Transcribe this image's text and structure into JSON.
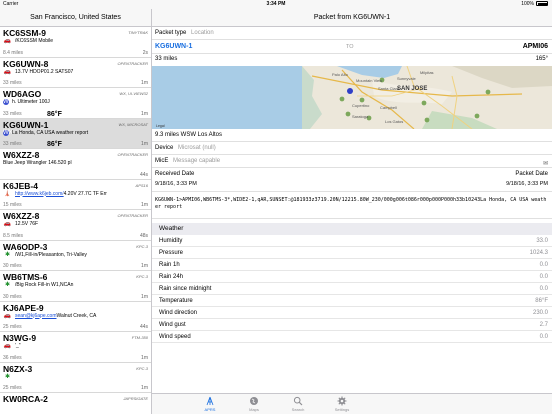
{
  "status_bar": {
    "carrier": "Carrier",
    "time": "3:34 PM",
    "battery": "100%"
  },
  "left": {
    "title": "San Francisco, United States",
    "stations": [
      {
        "callsign": "KC6SSM-9",
        "source": "TINYTRAK",
        "symbol": "🚗",
        "sym_class": "sym-car",
        "comment": "/KC6SSM Mobile",
        "distance": "8.4 miles",
        "age": "2s",
        "temp": "",
        "link": false
      },
      {
        "callsign": "KG6UWN-8",
        "source": "OPENTRACKER",
        "symbol": "🚗",
        "sym_class": "sym-car",
        "comment": "13.7V HDOP01.2 SATS07",
        "distance": "33 miles",
        "age": "1m",
        "temp": "",
        "link": false
      },
      {
        "callsign": "WD6AGO",
        "source": "WX, UI-VIEW32",
        "symbol": "WX",
        "sym_class": "sym-blue",
        "comment": "h. Ultimeter 100J",
        "distance": "33 miles",
        "age": "1m",
        "temp": "86°F",
        "link": false
      },
      {
        "callsign": "KG6UWN-1",
        "source": "WX, MICROSAT",
        "symbol": "WX",
        "sym_class": "sym-blue",
        "comment": "La Honda, CA USA  weather report",
        "distance": "33 miles",
        "age": "1m",
        "temp": "86°F",
        "link": false,
        "selected": true
      },
      {
        "callsign": "W6XZZ-8",
        "source": "OPENTRACKER",
        "symbol": "",
        "sym_class": "",
        "comment": "Blue Jeep Wrangler 146.520 pl",
        "distance": "",
        "age": "44s",
        "temp": "",
        "link": false
      },
      {
        "callsign": "K6JEB-4",
        "source": "APS16",
        "symbol": "🗼",
        "sym_class": "sym-gray",
        "comment": "http://www.k6jeb.com/",
        "comment2": " 4.20V  27.7C TF Err",
        "distance": "15 miles",
        "age": "1m",
        "temp": "",
        "link": true
      },
      {
        "callsign": "W6XZZ-8",
        "source": "OPENTRACKER",
        "symbol": "🚗",
        "sym_class": "sym-car",
        "comment": "12.5V  76F",
        "distance": "8.5 miles",
        "age": "48s",
        "temp": "",
        "link": false
      },
      {
        "callsign": "WA6ODP-3",
        "source": "KPC-3",
        "symbol": "✱",
        "sym_class": "sym-green",
        "comment": "/W1,Fill-in/Pleasanton, Tri-Valley",
        "distance": "30 miles",
        "age": "1m",
        "temp": "",
        "link": false
      },
      {
        "callsign": "WB6TMS-6",
        "source": "KPC-3",
        "symbol": "✱",
        "sym_class": "sym-green",
        "comment": "/Big Rock Fill-in W1,NCAn",
        "distance": "30 miles",
        "age": "1m",
        "temp": "",
        "link": false
      },
      {
        "callsign": "KJ6APE-9",
        "source": "",
        "symbol": "🚗",
        "sym_class": "sym-car",
        "comment": "sean@kj6ape.com",
        "comment2": " Walnut Creek, CA",
        "distance": "25 miles",
        "age": "44s",
        "temp": "",
        "link": true
      },
      {
        "callsign": "N3WG-9",
        "source": "FTM-350",
        "symbol": "🚗",
        "sym_class": "sym-car",
        "comment": "'_\"",
        "distance": "36 miles",
        "age": "1m",
        "temp": "",
        "link": false
      },
      {
        "callsign": "N6ZX-3",
        "source": "KPC-3",
        "symbol": "✱",
        "sym_class": "sym-green",
        "comment": "",
        "distance": "25 miles",
        "age": "1m",
        "temp": "",
        "link": false
      },
      {
        "callsign": "KW0RCA-2",
        "source": "JAPRSIGATE",
        "symbol": "",
        "sym_class": "",
        "comment": "",
        "distance": "",
        "age": "",
        "temp": "",
        "link": false
      }
    ]
  },
  "right": {
    "title": "Packet from KG6UWN-1",
    "packet_type_label": "Packet type",
    "packet_type_value": "Location",
    "from": "KG6UWN-1",
    "to_label": "TO",
    "to": "APMI06",
    "distance": "33 miles",
    "bearing": "165°",
    "map_legal": "Legal",
    "map_places": [
      "Sunnyvale",
      "Milpitas",
      "Santa Clara",
      "SAN JOSE",
      "Cupertino",
      "Saratoga",
      "Los Gatos",
      "Campbell",
      "Mountain View",
      "Palo Alto"
    ],
    "map_caption": "9.3 miles WSW Los Altos",
    "device_label": "Device",
    "device_value": "Microsat (null)",
    "mice_label": "MicE",
    "mice_value": "Message capable",
    "received_label": "Received Date",
    "received_value": "9/18/16, 3:33 PM",
    "packet_date_label": "Packet Date",
    "packet_date_value": "9/18/16, 3:33 PM",
    "raw_packet": "KG6UWN-1>APMI06,WB6TMS-3*,WIDE2-1,qAR,SUNSET:@181933z3719.20N/12215.80W_230/000g006t086r000p000P000h33b10243La Honda, CA USA  weather report",
    "weather_header": "Weather",
    "weather": [
      {
        "label": "Humidity",
        "value": "33.0"
      },
      {
        "label": "Pressure",
        "value": "1024.3"
      },
      {
        "label": "Rain 1h",
        "value": "0.0"
      },
      {
        "label": "Rain 24h",
        "value": "0.0"
      },
      {
        "label": "Rain since midnight",
        "value": "0.0"
      },
      {
        "label": "Temperature",
        "value": "86°F"
      },
      {
        "label": "Wind direction",
        "value": "230.0"
      },
      {
        "label": "Wind gust",
        "value": "2.7"
      },
      {
        "label": "Wind speed",
        "value": "0.0"
      }
    ]
  },
  "tabs": [
    {
      "label": "APRS",
      "icon": "antenna-icon",
      "active": true
    },
    {
      "label": "Maps",
      "icon": "globe-icon",
      "active": false
    },
    {
      "label": "Search",
      "icon": "search-icon",
      "active": false
    },
    {
      "label": "Settings",
      "icon": "gear-icon",
      "active": false
    }
  ],
  "colors": {
    "accent": "#1a6fe0",
    "selected_row": "#dcdcdc",
    "water": "#a8cce6",
    "land": "#ece7da"
  }
}
